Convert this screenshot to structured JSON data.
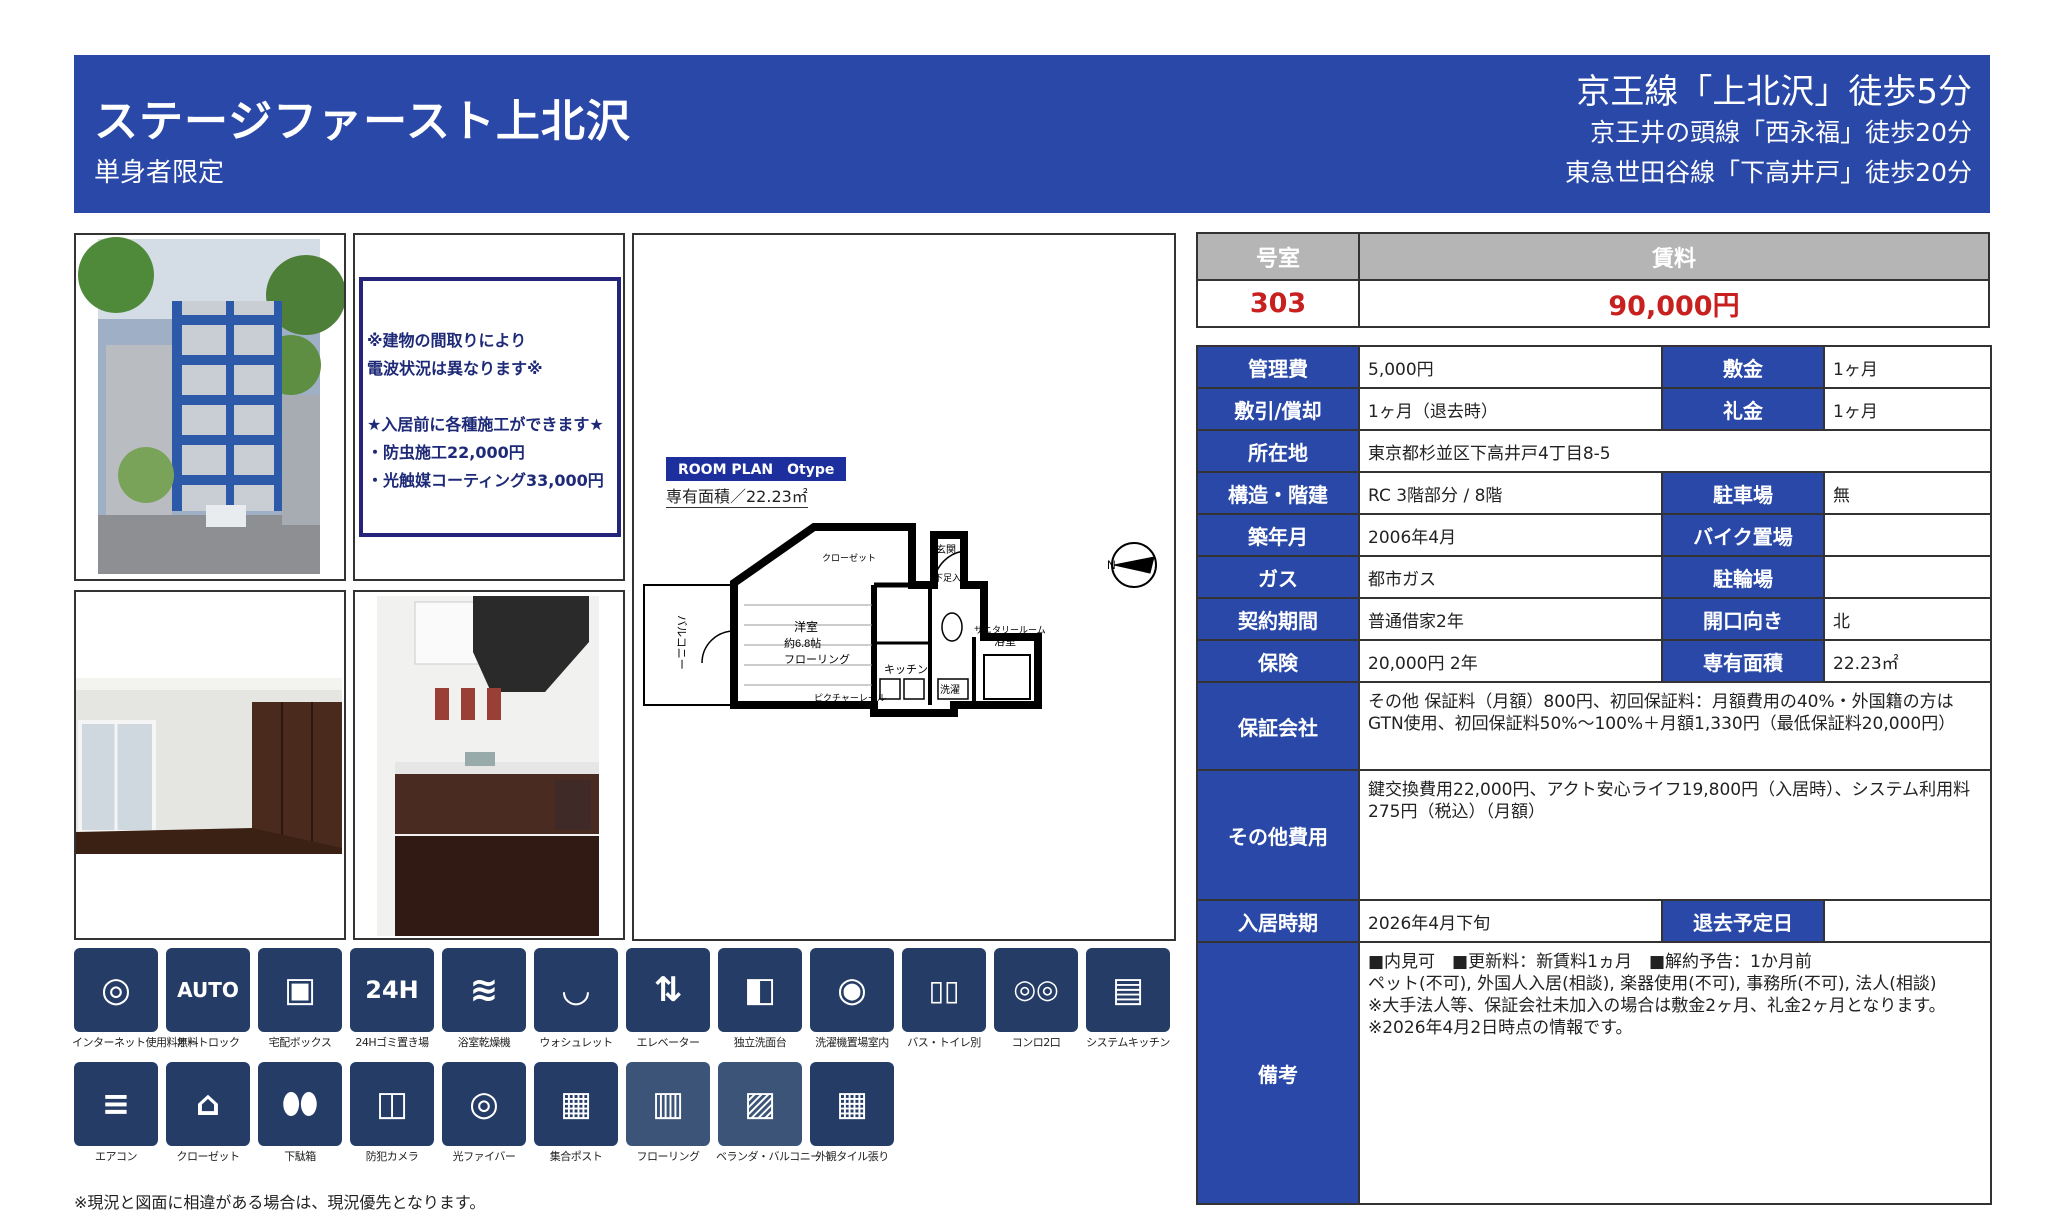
{
  "header": {
    "property_name": "ステージファースト上北沢",
    "subtitle": "単身者限定",
    "station_main": "京王線「上北沢」徒歩5分",
    "station_2": "京王井の頭線「西永福」徒歩20分",
    "station_3": "東急世田谷線「下高井戸」徒歩20分"
  },
  "notice": {
    "line1": "※建物の間取りにより",
    "line2": "電波状況は異なります※",
    "line3": "★入居前に各種施工ができます★",
    "line4": "・防虫施工22,000円",
    "line5": "・光触媒コーティング33,000円"
  },
  "floor_plan": {
    "title": "ROOM PLAN　Otype",
    "area": "専有面積／22.23㎡",
    "rooms": {
      "western": "洋室",
      "western_size": "約6.8帖",
      "flooring": "フローリング",
      "closet": "クローゼット",
      "entrance": "玄関",
      "shoebox": "下足入",
      "sanitary": "サニタリールーム",
      "bath": "浴室",
      "kitchen": "キッチン",
      "laundry": "洗濯",
      "balcony": "バルコニー",
      "picture_rail": "ピクチャーレール",
      "north": "N"
    }
  },
  "amenities_row1": [
    {
      "label": "インターネット使用料無料",
      "icon": "internet-icon",
      "glyph": "◎"
    },
    {
      "label": "オートロック",
      "icon": "autolock-icon",
      "glyph": "AUTO"
    },
    {
      "label": "宅配ボックス",
      "icon": "delivery-box-icon",
      "glyph": "▣"
    },
    {
      "label": "24Hゴミ置き場",
      "icon": "garbage-24h-icon",
      "glyph": "24H"
    },
    {
      "label": "浴室乾燥機",
      "icon": "bath-dryer-icon",
      "glyph": "≋"
    },
    {
      "label": "ウォシュレット",
      "icon": "washlet-icon",
      "glyph": "◡"
    },
    {
      "label": "エレベーター",
      "icon": "elevator-icon",
      "glyph": "⇅"
    },
    {
      "label": "独立洗面台",
      "icon": "washbasin-icon",
      "glyph": "◧"
    },
    {
      "label": "洗濯機置場室内",
      "icon": "washing-machine-icon",
      "glyph": "◉"
    },
    {
      "label": "バス・トイレ別",
      "icon": "bath-toilet-separate-icon",
      "glyph": "▯▯"
    },
    {
      "label": "コンロ2口",
      "icon": "stove-icon",
      "glyph": "◎◎"
    },
    {
      "label": "システムキッチン",
      "icon": "system-kitchen-icon",
      "glyph": "▤"
    }
  ],
  "amenities_row2": [
    {
      "label": "エアコン",
      "icon": "air-conditioner-icon",
      "glyph": "≡"
    },
    {
      "label": "クローゼット",
      "icon": "closet-icon",
      "glyph": "⌂"
    },
    {
      "label": "下駄箱",
      "icon": "shoe-box-icon",
      "glyph": "⬮⬮"
    },
    {
      "label": "防犯カメラ",
      "icon": "security-camera-icon",
      "glyph": "◫"
    },
    {
      "label": "光ファイバー",
      "icon": "fiber-optic-icon",
      "glyph": "◎"
    },
    {
      "label": "集合ポスト",
      "icon": "mailbox-icon",
      "glyph": "▦"
    },
    {
      "label": "フローリング",
      "icon": "flooring-icon",
      "glyph": "▥"
    },
    {
      "label": "ベランダ・バルコニー",
      "icon": "balcony-icon",
      "glyph": "▨"
    },
    {
      "label": "外観タイル張り",
      "icon": "tile-exterior-icon",
      "glyph": "▦"
    }
  ],
  "footnote": "※現況と図面に相違がある場合は、現況優先となります。",
  "room_rent": {
    "room_label": "号室",
    "rent_label": "賃料",
    "room": "303",
    "rent": "90,000円"
  },
  "details": {
    "mgmt_fee_label": "管理費",
    "mgmt_fee": "5,000円",
    "deposit_label": "敷金",
    "deposit": "1ヶ月",
    "shikibiki_label": "敷引/償却",
    "shikibiki": "1ヶ月（退去時）",
    "key_money_label": "礼金",
    "key_money": "1ヶ月",
    "address_label": "所在地",
    "address": "東京都杉並区下高井戸4丁目8-5",
    "structure_label": "構造・階建",
    "structure": "RC 3階部分 / 8階",
    "parking_label": "駐車場",
    "parking": "無",
    "built_label": "築年月",
    "built": "2006年4月",
    "bike_label": "バイク置場",
    "bike": "",
    "gas_label": "ガス",
    "gas": "都市ガス",
    "bicycle_label": "駐輪場",
    "bicycle": "",
    "contract_label": "契約期間",
    "contract": "普通借家2年",
    "facing_label": "開口向き",
    "facing": "北",
    "insurance_label": "保険",
    "insurance": "20,000円 2年",
    "area_label": "専有面積",
    "area": "22.23㎡",
    "guarantor_label": "保証会社",
    "guarantor": "その他 保証料（月額）800円、初回保証料：月額費用の40%・外国籍の方はGTN使用、初回保証料50%～100%＋月額1,330円（最低保証料20,000円）",
    "other_fees_label": "その他費用",
    "other_fees": "鍵交換費用22,000円、アクト安心ライフ19,800円（入居時）、システム利用料275円（税込）（月額）",
    "move_in_label": "入居時期",
    "move_in": "2026年4月下旬",
    "move_out_label": "退去予定日",
    "move_out": "",
    "remarks_label": "備考",
    "remarks_1": "■内見可　■更新料：新賃料1ヵ月　■解約予告：1か月前",
    "remarks_2": "ペット(不可), 外国人入居(相談), 楽器使用(不可), 事務所(不可), 法人(相談)",
    "remarks_3": "※大手法人等、保証会社未加入の場合は敷金2ヶ月、礼金2ヶ月となります。",
    "remarks_4": "※2026年4月2日時点の情報です。"
  }
}
